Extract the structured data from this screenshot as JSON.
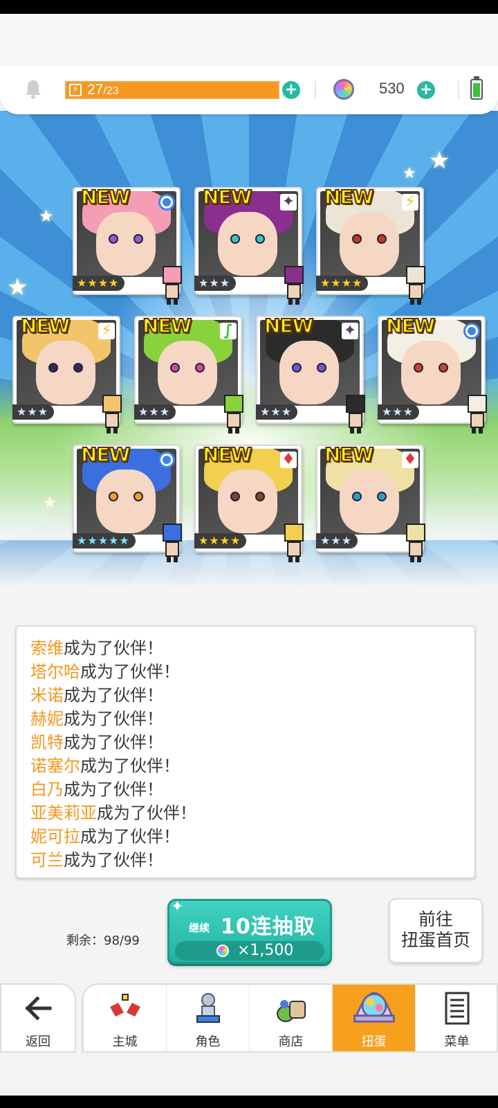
{
  "header": {
    "stamina_current": "27",
    "stamina_max": "/23",
    "gem_count": "530"
  },
  "cards": [
    {
      "new": "NEW",
      "attribute": "water",
      "rarity": "★★★★",
      "rarity_style": "gold",
      "hair": "#f59db5",
      "eye": "#8a5fd0"
    },
    {
      "new": "NEW",
      "attribute": "dark",
      "rarity": "★★★",
      "rarity_style": "silver",
      "hair": "#8a2f8e",
      "eye": "#35c7c2"
    },
    {
      "new": "NEW",
      "attribute": "thunder",
      "rarity": "★★★★",
      "rarity_style": "gold",
      "hair": "#ece4d6",
      "eye": "#c23a1c"
    },
    {
      "new": "NEW",
      "attribute": "thunder",
      "rarity": "★★★",
      "rarity_style": "silver",
      "hair": "#f3c56a",
      "eye": "#2d2d5a"
    },
    {
      "new": "NEW",
      "attribute": "wind",
      "rarity": "★★★",
      "rarity_style": "silver",
      "hair": "#88d23c",
      "eye": "#d04a9a"
    },
    {
      "new": "NEW",
      "attribute": "dark",
      "rarity": "★★★",
      "rarity_style": "silver",
      "hair": "#2b2b2b",
      "eye": "#6a5ad0"
    },
    {
      "new": "NEW",
      "attribute": "water",
      "rarity": "★★★",
      "rarity_style": "silver",
      "hair": "#f3efe5",
      "eye": "#d0403a"
    },
    {
      "new": "NEW",
      "attribute": "water",
      "rarity": "★★★★★",
      "rarity_style": "rainbow",
      "hair": "#3b6fe0",
      "eye": "#f0a020"
    },
    {
      "new": "NEW",
      "attribute": "fire",
      "rarity": "★★★★",
      "rarity_style": "gold",
      "hair": "#f2cf4e",
      "eye": "#7a4a2a"
    },
    {
      "new": "NEW",
      "attribute": "fire",
      "rarity": "★★★",
      "rarity_style": "silver",
      "hair": "#efe1a4",
      "eye": "#2aa0c8"
    }
  ],
  "messages": [
    {
      "name": "索维",
      "suffix": "成为了伙伴！"
    },
    {
      "name": "塔尔哈",
      "suffix": "成为了伙伴！"
    },
    {
      "name": "米诺",
      "suffix": "成为了伙伴！"
    },
    {
      "name": "赫妮",
      "suffix": "成为了伙伴！"
    },
    {
      "name": "凯特",
      "suffix": "成为了伙伴！"
    },
    {
      "name": "诺塞尔",
      "suffix": "成为了伙伴！"
    },
    {
      "name": "白乃",
      "suffix": "成为了伙伴！"
    },
    {
      "name": "亚美莉亚",
      "suffix": "成为了伙伴！"
    },
    {
      "name": "妮可拉",
      "suffix": "成为了伙伴！"
    },
    {
      "name": "可兰",
      "suffix": "成为了伙伴！"
    }
  ],
  "gacha": {
    "remaining": "剩余：98/99",
    "continue_label": "继续",
    "draw_label": "10连抽取",
    "cost": "×1,500",
    "home_line1": "前往",
    "home_line2": "扭蛋首页"
  },
  "nav": {
    "back": "返回",
    "tabs": [
      "主城",
      "角色",
      "商店",
      "扭蛋",
      "菜单"
    ],
    "active_tab": "扭蛋"
  },
  "colors": {
    "accent_orange": "#f7a01e",
    "teal": "#22b3a1",
    "name_highlight": "#f5961e"
  }
}
